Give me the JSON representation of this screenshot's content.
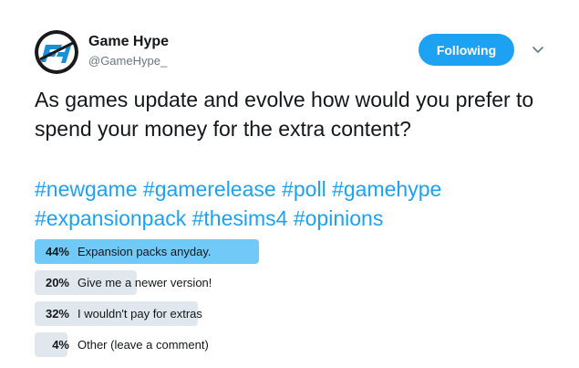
{
  "author": {
    "display_name": "Game Hype",
    "handle": "@GameHype_",
    "avatar_icon": "game-hype-logo-icon"
  },
  "follow_button": {
    "label": "Following"
  },
  "menu": {
    "icon": "chevron-down-icon"
  },
  "tweet": {
    "text": "As games update and evolve how would you prefer to spend your money for the extra content?",
    "hashtags": [
      "#newgame",
      "#gamerelease",
      "#poll",
      "#gamehype",
      "#expansionpack",
      "#thesims4",
      "#opinions"
    ]
  },
  "poll": {
    "options": [
      {
        "percent": "44%",
        "label": "Expansion packs anyday.",
        "value": 0.44,
        "winner": true
      },
      {
        "percent": "20%",
        "label": "Give me a newer version!",
        "value": 0.2,
        "winner": false
      },
      {
        "percent": "32%",
        "label": "I wouldn't pay for extras",
        "value": 0.32,
        "winner": false
      },
      {
        "percent": "4%",
        "label": "Other (leave a comment)",
        "value": 0.04,
        "winner": false
      }
    ]
  },
  "colors": {
    "accent": "#1da1f2",
    "winner_bar": "#71c9f8",
    "bar": "#e1e8ed"
  }
}
